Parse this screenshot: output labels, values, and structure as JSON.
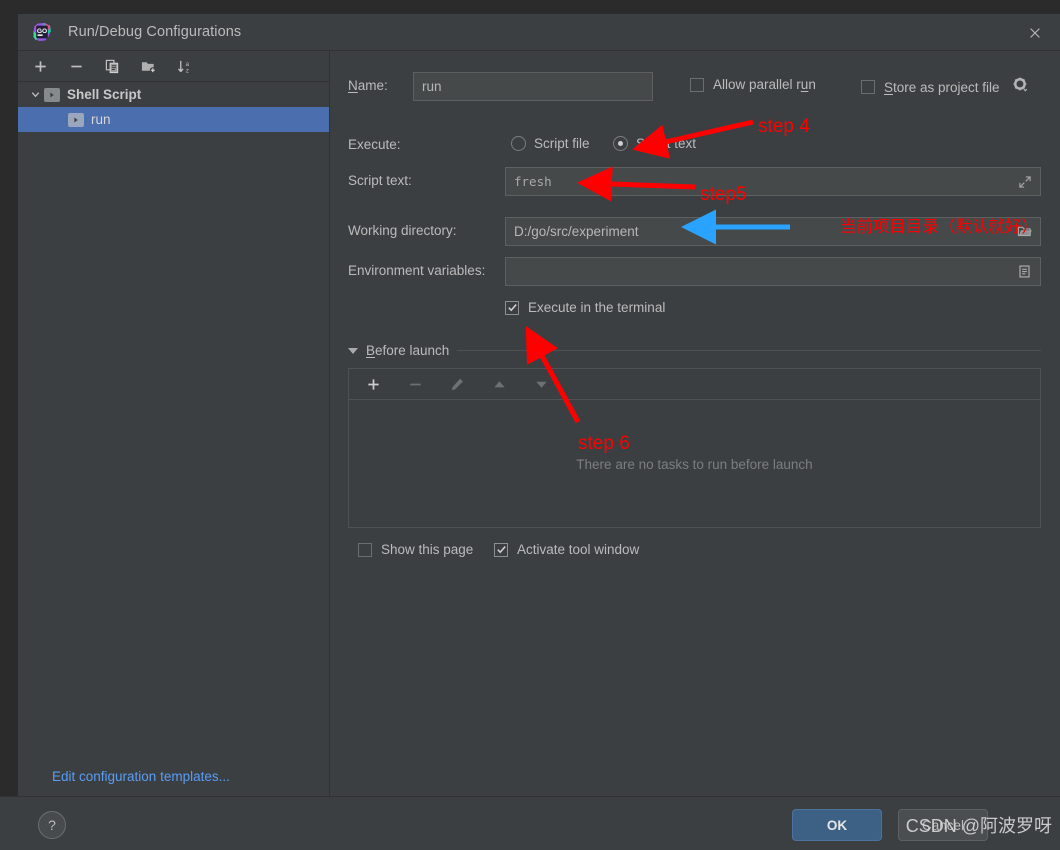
{
  "window": {
    "title": "Run/Debug Configurations",
    "app_icon": "goland-icon",
    "close_icon": "close-icon"
  },
  "sidebar": {
    "toolbar": [
      {
        "name": "add-configuration-button",
        "icon": "plus-icon"
      },
      {
        "name": "remove-configuration-button",
        "icon": "minus-icon"
      },
      {
        "name": "copy-configuration-button",
        "icon": "copy-icon"
      },
      {
        "name": "new-folder-button",
        "icon": "folder-add-icon"
      },
      {
        "name": "sort-configurations-button",
        "icon": "sort-az-icon"
      }
    ],
    "tree": [
      {
        "label": "Shell Script",
        "type": "group",
        "expanded": true,
        "selected": false
      },
      {
        "label": "run",
        "type": "child",
        "selected": true
      }
    ],
    "edit_templates_link": "Edit configuration templates..."
  },
  "form": {
    "name_label": "Name:",
    "name_value": "run",
    "allow_parallel_run_label": "Allow parallel run",
    "allow_parallel_run_checked": false,
    "store_as_project_file_label": "Store as project file",
    "store_as_project_file_checked": false,
    "store_gear_icon": "gear-icon",
    "execute_label": "Execute:",
    "execute_options": [
      {
        "label": "Script file",
        "selected": false
      },
      {
        "label": "Script text",
        "selected": true
      }
    ],
    "script_text_label": "Script text:",
    "script_text_value": "fresh",
    "script_text_expand_icon": "expand-icon",
    "working_directory_label": "Working directory:",
    "working_directory_value": "D:/go/src/experiment",
    "working_directory_browse_icon": "folder-icon",
    "environment_variables_label": "Environment variables:",
    "environment_variables_value": "",
    "environment_variables_icon": "list-edit-icon",
    "execute_in_terminal_label": "Execute in the terminal",
    "execute_in_terminal_checked": true
  },
  "before_launch": {
    "section_label": "Before launch",
    "expanded": true,
    "toolbar": [
      {
        "name": "add-task-button",
        "icon": "plus-icon",
        "enabled": true
      },
      {
        "name": "remove-task-button",
        "icon": "minus-icon",
        "enabled": false
      },
      {
        "name": "edit-task-button",
        "icon": "pencil-icon",
        "enabled": false
      },
      {
        "name": "move-up-button",
        "icon": "arrow-up-icon",
        "enabled": false
      },
      {
        "name": "move-down-button",
        "icon": "arrow-down-icon",
        "enabled": false
      }
    ],
    "empty_text": "There are no tasks to run before launch",
    "show_this_page_label": "Show this page",
    "show_this_page_checked": false,
    "activate_tool_window_label": "Activate tool window",
    "activate_tool_window_checked": true
  },
  "footer": {
    "help_label": "?",
    "ok_label": "OK",
    "cancel_label": "Cancel"
  },
  "watermark": "CSDN @阿波罗呀",
  "annotations": [
    {
      "id": "step4",
      "text": "step 4",
      "color": "#ff0000"
    },
    {
      "id": "step5",
      "text": "step5",
      "color": "#ff0000"
    },
    {
      "id": "step6",
      "text": "step 6",
      "color": "#ff0000"
    },
    {
      "id": "cn-note",
      "text": "当前项目目录（默认就好）",
      "color": "#ff0000"
    }
  ],
  "colors": {
    "window_bg": "#3c3f41",
    "outer_bg": "#2b2b2b",
    "selection_blue": "#4b6eaf",
    "link_blue": "#589df6",
    "ok_button": "#3d6185",
    "annotation_red": "#ff0000",
    "annotation_blue": "#29a3ff",
    "field_bg": "#45494a"
  }
}
